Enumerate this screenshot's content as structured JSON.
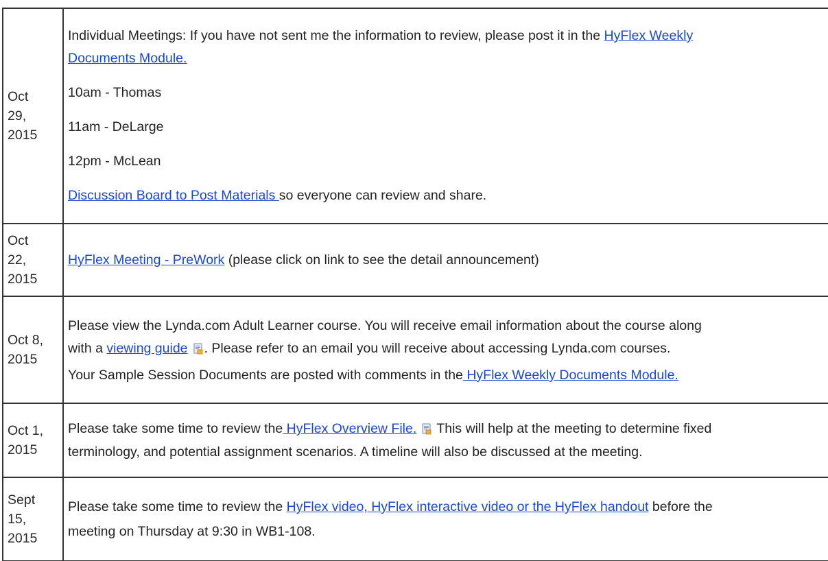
{
  "rows": [
    {
      "date": [
        "Oct",
        "29,",
        "2015"
      ],
      "intro_text": "Individual Meetings: If you have not sent me the information to review, please post it in the ",
      "intro_link_line1": "HyFlex Weekly",
      "intro_link_line2": "Documents Module.",
      "agenda": [
        "10am - Thomas",
        "11am - DeLarge",
        "12pm - McLean"
      ],
      "discussion_link": "Discussion Board to Post Materials ",
      "discussion_text": "so everyone can review and share."
    },
    {
      "date": [
        "Oct",
        "22,",
        "2015"
      ],
      "link": "HyFlex Meeting - PreWork",
      "text": " (please click on link to see the detail announcement)"
    },
    {
      "date": [
        "Oct 8,",
        "2015"
      ],
      "line1": "Please view the Lynda.com Adult Learner course. You will receive email information about the course along",
      "line2_prefix": "with a ",
      "line2_link": "viewing guide",
      "line2_suffix": ". Please refer to an email you will receive about accessing Lynda.com courses.",
      "line3_prefix": "Your Sample Session Documents are posted with comments in the",
      "line3_link": " HyFlex Weekly Documents Module."
    },
    {
      "date": [
        "Oct 1,",
        "2015"
      ],
      "line1_prefix": "Please take some time to review the",
      "line1_link": " HyFlex Overview File.",
      "line1_suffix": " This will help at the meeting to determine fixed",
      "line2": "terminology, and potential assignment scenarios. A timeline will also be discussed at the meeting."
    },
    {
      "date": [
        "Sept",
        "15,",
        "2015"
      ],
      "line1_prefix": "Please take some time to review the ",
      "line1_link": "HyFlex video, HyFlex interactive video or the HyFlex handout",
      "line1_suffix": " before the",
      "line2": "meeting on Thursday at 9:30 in WB1-108."
    }
  ],
  "icons": {
    "document": "document-attachment-icon"
  },
  "colors": {
    "link": "#1a47d6",
    "text": "#222222",
    "border": "#333333"
  }
}
